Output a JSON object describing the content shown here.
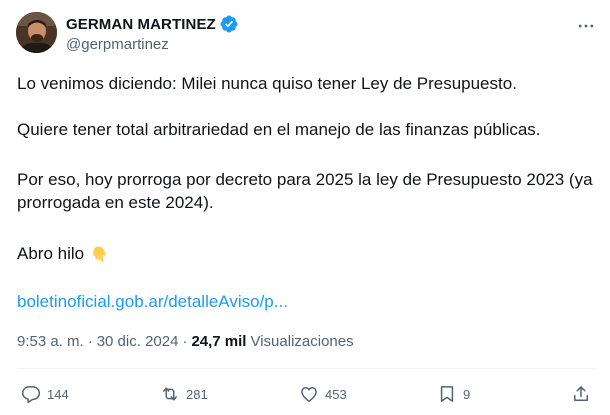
{
  "author": {
    "display_name": "GERMAN MARTINEZ",
    "handle": "@gerpmartinez",
    "verified": true
  },
  "tweet": {
    "paragraphs": [
      "Lo venimos diciendo: Milei nunca quiso tener Ley de Presupuesto.",
      "Quiere tener total arbitrariedad en el manejo de las finanzas públicas.",
      "Por eso, hoy prorroga por decreto para 2025 la ley de Presupuesto 2023 (ya prorrogada en este 2024).",
      "Abro hilo"
    ],
    "link_text": "boletinoficial.gob.ar/detalleAviso/p..."
  },
  "meta": {
    "time": "9:53 a. m.",
    "separator": "·",
    "date": "30 dic. 2024",
    "views_count": "24,7 mil",
    "views_label": "Visualizaciones"
  },
  "actions": {
    "replies": "144",
    "reposts": "281",
    "likes": "453",
    "bookmarks": "9"
  },
  "colors": {
    "accent": "#1d9bf0",
    "muted": "#536471",
    "text": "#0f1419"
  },
  "icons": {
    "more": "more-horizontal-icon",
    "verified": "verified-badge-icon",
    "emoji": "backhand-index-pointing-down-emoji",
    "reply": "reply-icon",
    "repost": "repost-icon",
    "like": "heart-icon",
    "bookmark": "bookmark-icon",
    "share": "share-icon"
  }
}
